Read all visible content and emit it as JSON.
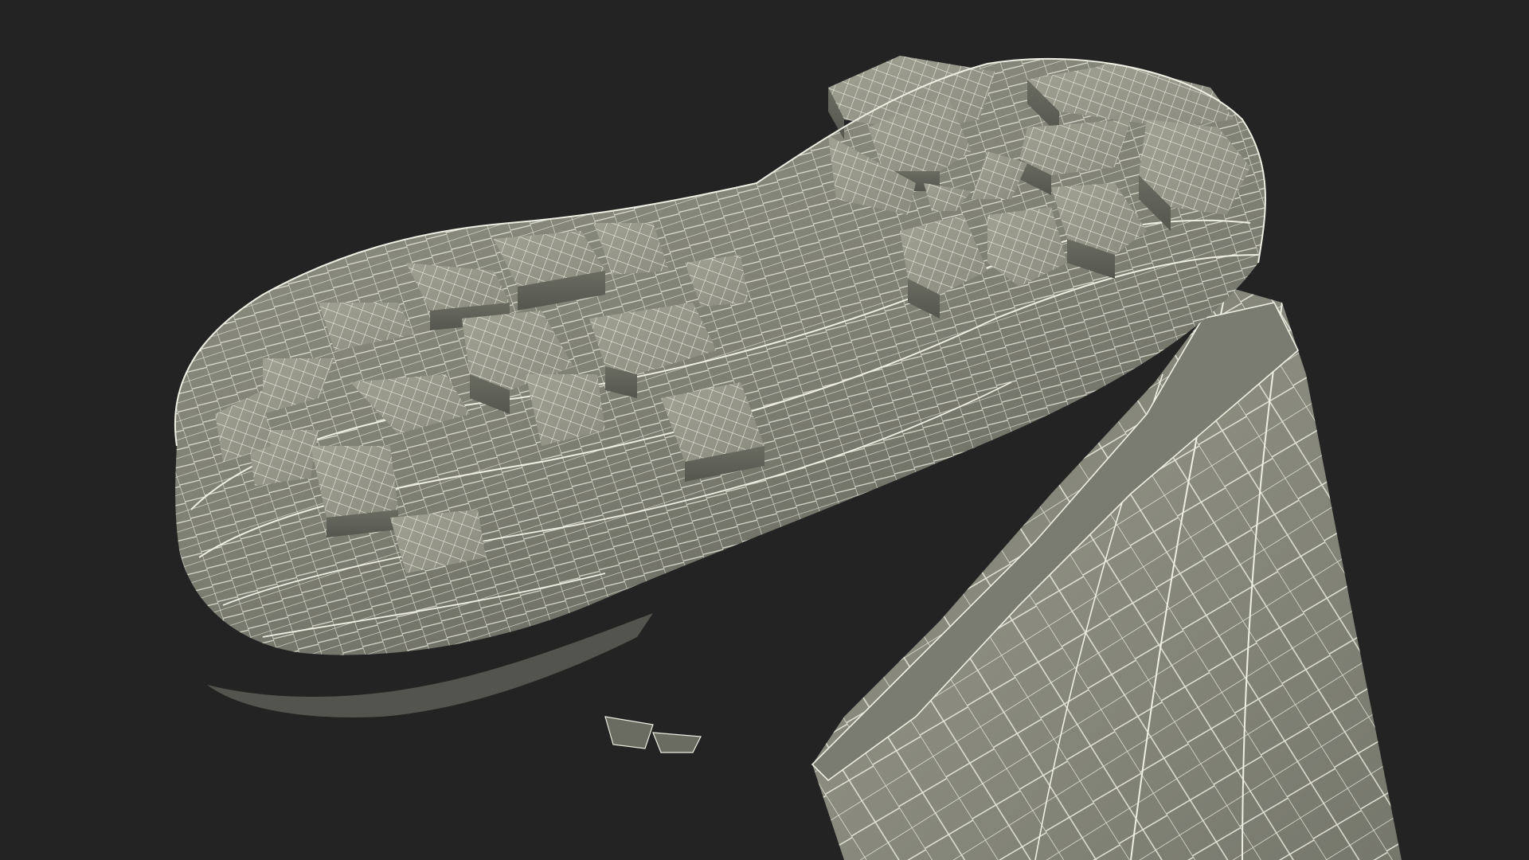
{
  "scene": {
    "background_color": "#232323",
    "mesh_fill_color": "#8a8b7e",
    "mesh_fill_shadow": "#5d5e55",
    "mesh_fill_highlight": "#a4a597",
    "wire_color": "#f1f1e7",
    "subject_icon": "boot-wireframe-render"
  }
}
